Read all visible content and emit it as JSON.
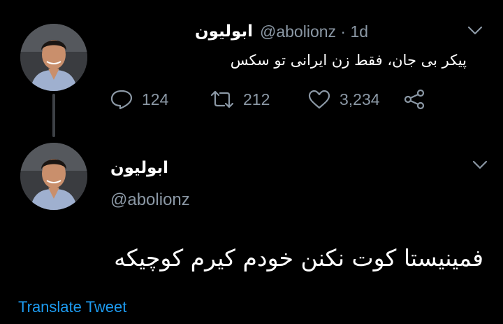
{
  "tweet1": {
    "display_name": "ابولیون",
    "handle": "@abolionz",
    "separator": "·",
    "age": "1d",
    "text": "پیکر بی جان، فقط زن ایرانی تو سکس",
    "actions": {
      "replies": "124",
      "retweets": "212",
      "likes": "3,234"
    }
  },
  "tweet2": {
    "display_name": "ابولیون",
    "handle": "@abolionz",
    "text": "فمینیستا کوت نکنن خودم کیرم کوچیکه",
    "translate_label": "Translate Tweet"
  },
  "colors": {
    "background": "#000000",
    "text": "#ffffff",
    "secondary": "#8b98a5",
    "accent": "#1d9bf0",
    "thread_line": "#3d4146"
  }
}
